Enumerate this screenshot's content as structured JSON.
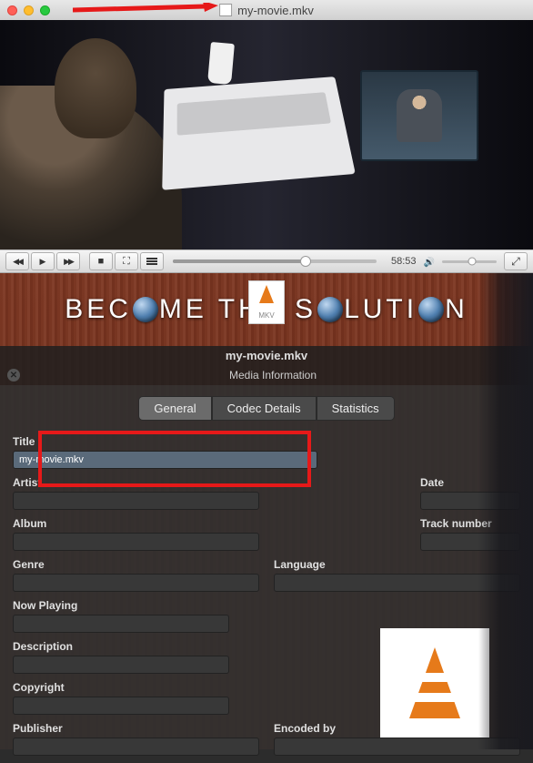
{
  "titlebar": {
    "filename": "my-movie.mkv"
  },
  "playback": {
    "time": "58:53"
  },
  "banner": {
    "text_parts": [
      "BEC",
      "ME THE S",
      "LUTI",
      "N"
    ],
    "mkv_label": "MKV"
  },
  "media_info": {
    "filename": "my-movie.mkv",
    "panel_title": "Media Information",
    "tabs": {
      "general": "General",
      "codec": "Codec Details",
      "stats": "Statistics"
    },
    "fields": {
      "title_label": "Title",
      "title_value": "my-movie.mkv",
      "artist_label": "Artist",
      "artist_value": "",
      "date_label": "Date",
      "date_value": "",
      "album_label": "Album",
      "album_value": "",
      "track_label": "Track number",
      "track_value": "",
      "genre_label": "Genre",
      "genre_value": "",
      "language_label": "Language",
      "language_value": "",
      "nowplaying_label": "Now Playing",
      "nowplaying_value": "",
      "description_label": "Description",
      "description_value": "",
      "copyright_label": "Copyright",
      "copyright_value": "",
      "publisher_label": "Publisher",
      "publisher_value": "",
      "encodedby_label": "Encoded by",
      "encodedby_value": ""
    }
  }
}
